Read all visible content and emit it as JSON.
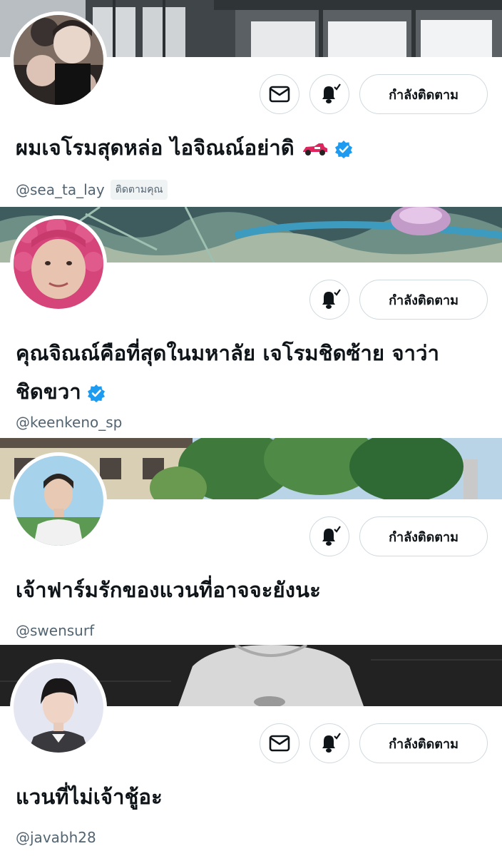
{
  "profiles": [
    {
      "name": "ผมเจโรมสุดหล่อ ไอจิณณ์อย่าดิ",
      "handle": "@sea_ta_lay",
      "follows_you": "ติดตามคุณ",
      "follow_label": "กำลังติดตาม",
      "verified": true,
      "emoji": "racing-car-icon",
      "has_message_button": true
    },
    {
      "name": "คุณจิณณ์คือที่สุดในมหาลัย เจโรมชิดซ้าย จาว่าชิดขวา",
      "handle": "@keenkeno_sp",
      "follow_label": "กำลังติดตาม",
      "verified": true,
      "has_message_button": false
    },
    {
      "name": "เจ้าฟาร์มรักของแวนที่อาจจะยังนะ",
      "handle": "@swensurf",
      "follow_label": "กำลังติดตาม",
      "verified": false,
      "has_message_button": false
    },
    {
      "name": "แวนที่ไม่เจ้าชู้อะ",
      "handle": "@javabh28",
      "follow_label": "กำลังติดตาม",
      "verified": false,
      "has_message_button": true
    }
  ],
  "colors": {
    "verified_blue": "#1d9bf0",
    "border": "#cfd9de",
    "secondary_text": "#536471"
  }
}
